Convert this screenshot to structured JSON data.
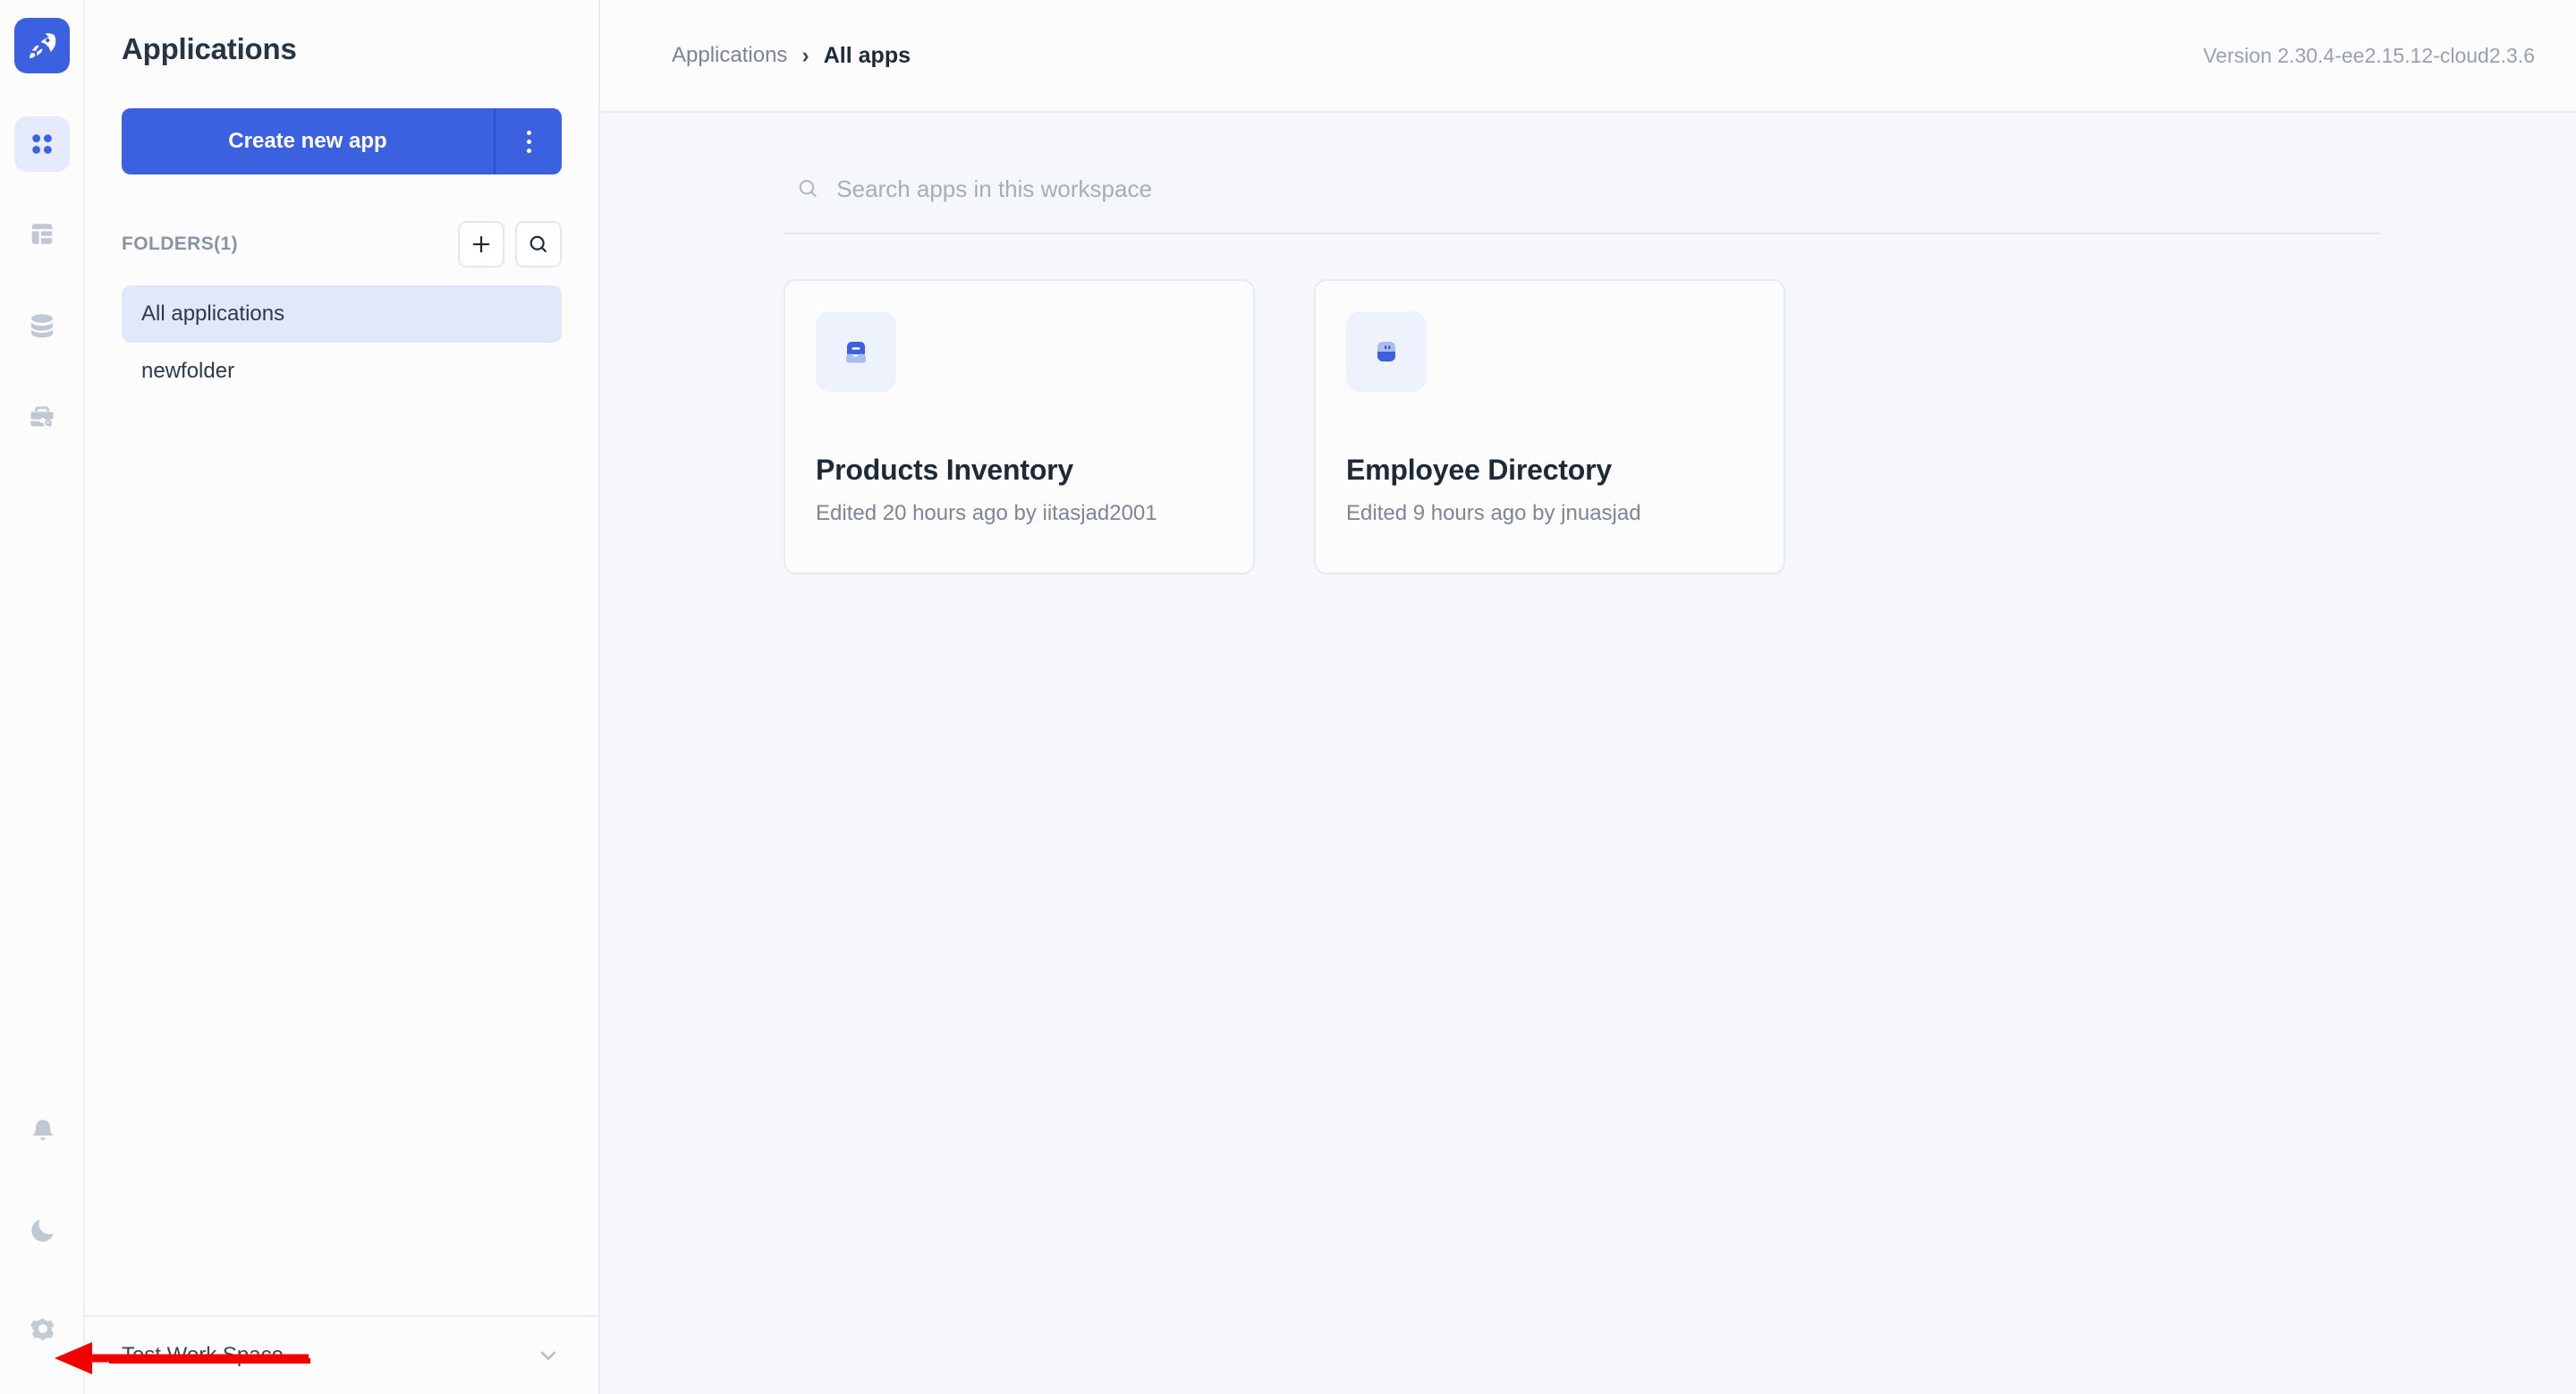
{
  "rail": {
    "logo_icon": "rocket-icon",
    "items": [
      {
        "icon": "grid-apps-icon",
        "name": "applications",
        "active": true
      },
      {
        "icon": "layout-template-icon",
        "name": "templates",
        "active": false
      },
      {
        "icon": "database-icon",
        "name": "data-sources",
        "active": false
      },
      {
        "icon": "briefcase-key-icon",
        "name": "workspace-constants",
        "active": false
      }
    ],
    "bottom_items": [
      {
        "icon": "bell-icon",
        "name": "notifications"
      },
      {
        "icon": "moon-icon",
        "name": "dark-mode-toggle"
      },
      {
        "icon": "gear-icon",
        "name": "settings"
      }
    ]
  },
  "sidebar": {
    "title": "Applications",
    "create_button_label": "Create new app",
    "create_kebab_icon": "kebab-menu-icon",
    "folders_label": "FOLDERS(1)",
    "add_folder_icon": "plus-icon",
    "search_folder_icon": "search-icon",
    "folders": [
      {
        "label": "All applications",
        "selected": true
      },
      {
        "label": "newfolder",
        "selected": false
      }
    ],
    "workspace_name": "Test Work Space",
    "workspace_chevron_icon": "chevron-down-icon"
  },
  "topbar": {
    "breadcrumb_root": "Applications",
    "breadcrumb_separator": "›",
    "breadcrumb_current": "All apps",
    "version": "Version 2.30.4-ee2.15.12-cloud2.3.6"
  },
  "search": {
    "placeholder": "Search apps in this workspace",
    "value": "",
    "icon": "search-icon"
  },
  "apps": [
    {
      "title": "Products Inventory",
      "meta": "Edited 20 hours ago by iitasjad2001",
      "icon": "inbox-icon"
    },
    {
      "title": "Employee Directory",
      "meta": "Edited 9 hours ago by jnuasjad",
      "icon": "robot-icon"
    }
  ],
  "annotation": {
    "type": "arrow-pointing-left",
    "target": "gear-icon",
    "color": "#f20000"
  },
  "colors": {
    "brand_blue": "#3b61e0",
    "selected_bg": "#e2e8fa",
    "page_bg": "#f5f7fa",
    "panel_bg": "#fcfcfd",
    "annotation_red": "#f20000"
  }
}
